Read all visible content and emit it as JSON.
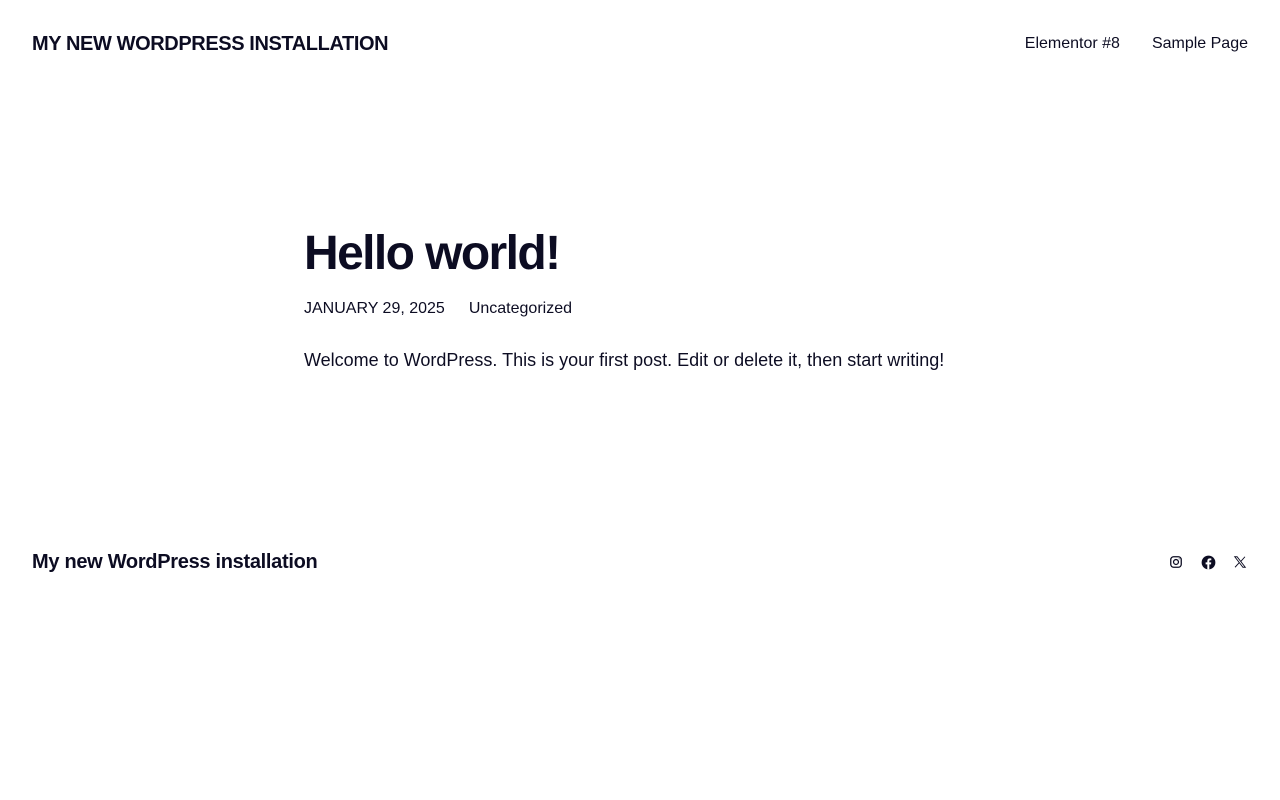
{
  "header": {
    "site_title": "MY NEW WORDPRESS INSTALLATION",
    "nav": [
      {
        "label": "Elementor #8"
      },
      {
        "label": "Sample Page"
      }
    ]
  },
  "post": {
    "title": "Hello world!",
    "date": "JANUARY 29, 2025",
    "category": "Uncategorized",
    "content": "Welcome to WordPress. This is your first post. Edit or delete it, then start writing!"
  },
  "footer": {
    "site_title": "My new WordPress installation",
    "social_icons": [
      "instagram-icon",
      "facebook-icon",
      "x-icon"
    ]
  },
  "colors": {
    "text": "#0c0c22",
    "background": "#ffffff"
  }
}
